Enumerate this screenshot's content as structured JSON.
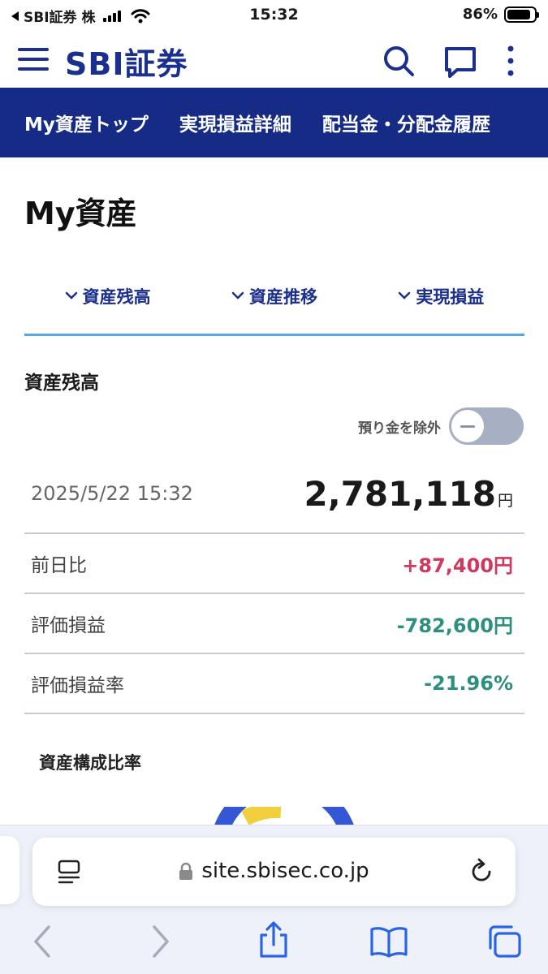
{
  "status_bar": {
    "back_app": "SBI証券 株",
    "time": "15:32",
    "battery": "86%",
    "battery_level": 0.86
  },
  "header": {
    "logo": "SBI証券",
    "icons": [
      "menu-icon",
      "search-icon",
      "chat-icon",
      "more-icon"
    ]
  },
  "nav": {
    "items": [
      "My資産トップ",
      "実現損益詳細",
      "配当金・分配金履歴"
    ]
  },
  "page": {
    "title": "My資産"
  },
  "anchor_tabs": [
    "資産残高",
    "資産推移",
    "実現損益"
  ],
  "balance": {
    "section_title": "資産残高",
    "toggle_label": "預り金を除外",
    "toggle_on": false,
    "date": "2025/5/22 15:32",
    "total": "2,781,118",
    "unit": "円",
    "rows": [
      {
        "label": "前日比",
        "value": "+87,400円",
        "tone": "pos"
      },
      {
        "label": "評価損益",
        "value": "-782,600円",
        "tone": "neg"
      },
      {
        "label": "評価損益率",
        "value": "-21.96%",
        "tone": "neg"
      }
    ]
  },
  "composition": {
    "title": "資産構成比率"
  },
  "browser": {
    "url": "site.sbisec.co.jp"
  },
  "colors": {
    "brand": "#152b85",
    "accent_line": "#5aa6e0",
    "positive": "#d0395f",
    "negative": "#2f8f7f",
    "donut_blue": "#3557d6",
    "donut_yellow": "#f2cf3c"
  }
}
